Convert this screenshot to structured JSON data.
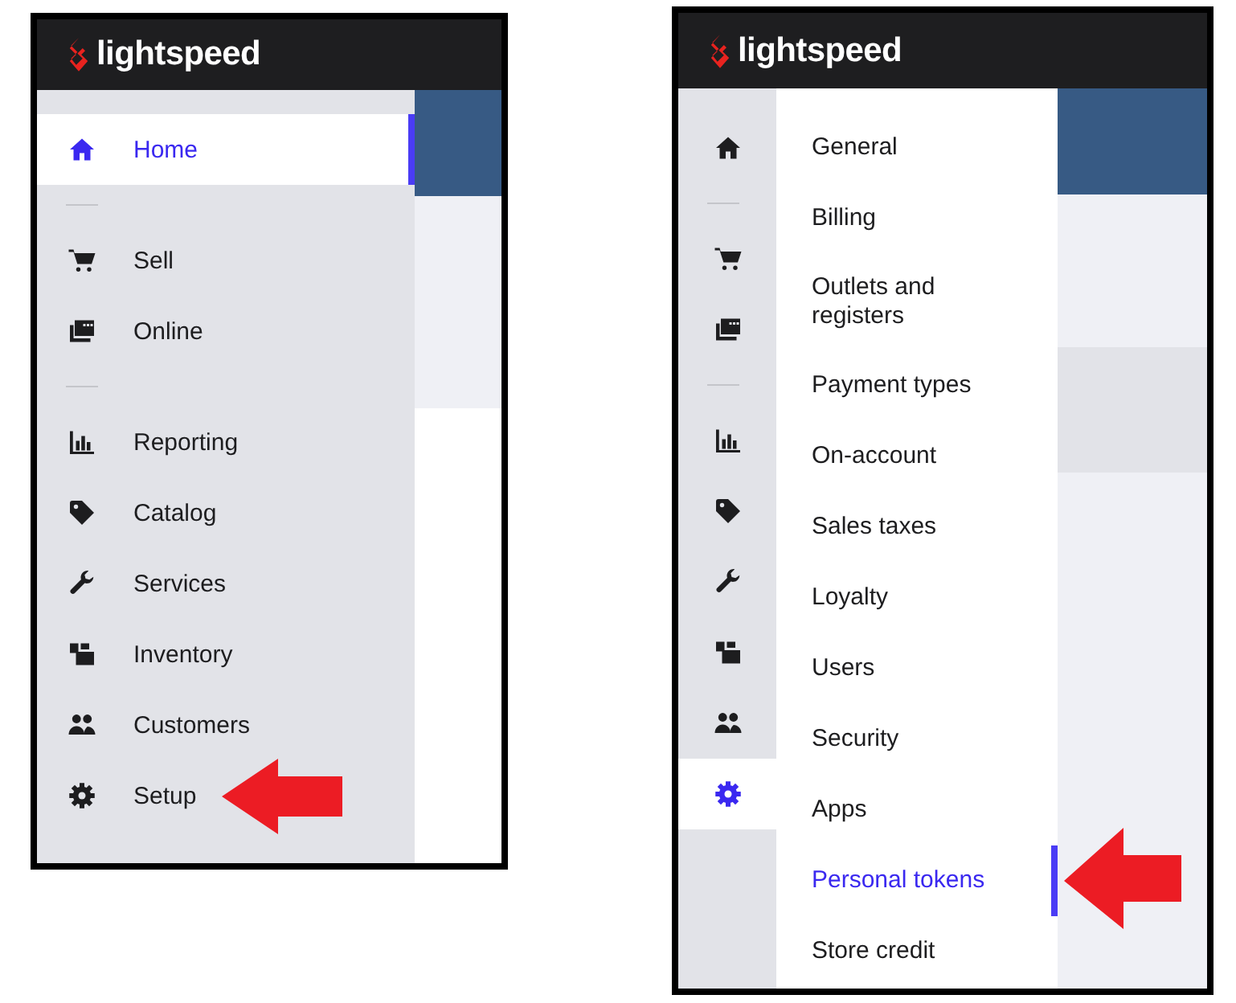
{
  "screens": [
    {
      "kind": "main_menu",
      "logo": "lightspeed",
      "nav": [
        {
          "kind": "item",
          "label": "Home",
          "selected": true,
          "pointed": false
        },
        {
          "kind": "divider"
        },
        {
          "kind": "item",
          "label": "Sell",
          "selected": false,
          "pointed": false
        },
        {
          "kind": "item",
          "label": "Online",
          "selected": false,
          "pointed": false
        },
        {
          "kind": "divider"
        },
        {
          "kind": "item",
          "label": "Reporting",
          "selected": false,
          "pointed": false
        },
        {
          "kind": "item",
          "label": "Catalog",
          "selected": false,
          "pointed": false
        },
        {
          "kind": "item",
          "label": "Services",
          "selected": false,
          "pointed": false
        },
        {
          "kind": "item",
          "label": "Inventory",
          "selected": false,
          "pointed": false
        },
        {
          "kind": "item",
          "label": "Customers",
          "selected": false,
          "pointed": false
        },
        {
          "kind": "item",
          "label": "Setup",
          "selected": false,
          "pointed": true
        }
      ]
    },
    {
      "kind": "setup_menu",
      "logo": "lightspeed",
      "rail": [
        {
          "kind": "item",
          "selected": false
        },
        {
          "kind": "divider"
        },
        {
          "kind": "item",
          "selected": false
        },
        {
          "kind": "item",
          "selected": false
        },
        {
          "kind": "divider"
        },
        {
          "kind": "item",
          "selected": false
        },
        {
          "kind": "item",
          "selected": false
        },
        {
          "kind": "item",
          "selected": false
        },
        {
          "kind": "item",
          "selected": false
        },
        {
          "kind": "item",
          "selected": false
        },
        {
          "kind": "item",
          "selected": true
        }
      ],
      "submenu": [
        {
          "label": "General",
          "selected": false,
          "pointed": false
        },
        {
          "label": "Billing",
          "selected": false,
          "pointed": false
        },
        {
          "label": "Outlets and registers",
          "selected": false,
          "pointed": false
        },
        {
          "label": "Payment types",
          "selected": false,
          "pointed": false
        },
        {
          "label": "On-account",
          "selected": false,
          "pointed": false
        },
        {
          "label": "Sales taxes",
          "selected": false,
          "pointed": false
        },
        {
          "label": "Loyalty",
          "selected": false,
          "pointed": false
        },
        {
          "label": "Users",
          "selected": false,
          "pointed": false
        },
        {
          "label": "Security",
          "selected": false,
          "pointed": false
        },
        {
          "label": "Apps",
          "selected": false,
          "pointed": false
        },
        {
          "label": "Personal tokens",
          "selected": true,
          "pointed": true
        },
        {
          "label": "Store credit",
          "selected": false,
          "pointed": false
        }
      ]
    }
  ]
}
